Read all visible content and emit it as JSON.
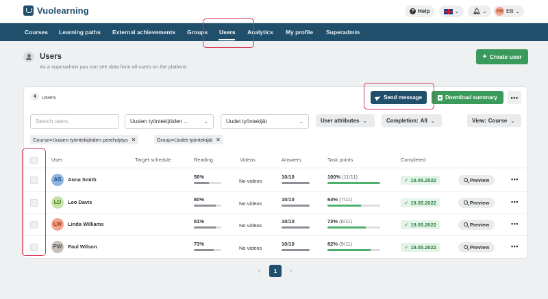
{
  "app": {
    "name": "Vuolearning"
  },
  "topbar": {
    "help": "Help",
    "user_initials": "EM",
    "user_name": "Elli"
  },
  "nav": [
    "Courses",
    "Learning paths",
    "External achievements",
    "Groups",
    "Users",
    "Analytics",
    "My profile",
    "Superadmin"
  ],
  "nav_active": "Users",
  "page": {
    "title": "Users",
    "subtitle": "As a superadmin you can see data from all users on the platform",
    "create_label": "Create user"
  },
  "card": {
    "count": "4",
    "count_label": "users",
    "send_label": "Send message",
    "download_label": "Download summary",
    "more": "•••"
  },
  "filters": {
    "search_placeholder": "Search users",
    "select1": "Uusien työntekijöiden ...",
    "select2": "Uudet työntekijät",
    "attributes": "User attributes",
    "completion_label": "Completion:",
    "completion_value": "All",
    "view_label": "View:",
    "view_value": "Course"
  },
  "tags": [
    "Course=Uusien työntekijöiden perehdytys",
    "Group=Uudet työntekijät"
  ],
  "table": {
    "headers": [
      "User",
      "Target schedule",
      "Reading",
      "Videos",
      "Answers",
      "Task points",
      "Completed"
    ],
    "rows": [
      {
        "initials": "AS",
        "name": "Anna Smith",
        "avatar_bg": "#8fb4dd",
        "avatar_fg": "#1f4f86",
        "reading": "56%",
        "reading_frac": 0.56,
        "videos": "No videos",
        "answers": "10/10",
        "answers_frac": 1.0,
        "task": "100%",
        "task_detail": "(11/11)",
        "task_frac": 1.0,
        "completed": "19.05.2022",
        "preview": "Preview",
        "more": "•••"
      },
      {
        "initials": "LD",
        "name": "Leo Davis",
        "avatar_bg": "#c5e2a8",
        "avatar_fg": "#4d7a25",
        "reading": "80%",
        "reading_frac": 0.8,
        "videos": "No videos",
        "answers": "10/10",
        "answers_frac": 1.0,
        "task": "64%",
        "task_detail": "(7/11)",
        "task_frac": 0.64,
        "completed": "19.05.2022",
        "preview": "Preview",
        "more": "•••"
      },
      {
        "initials": "LW",
        "name": "Linda Williams",
        "avatar_bg": "#f2a48c",
        "avatar_fg": "#a23d1c",
        "reading": "81%",
        "reading_frac": 0.81,
        "videos": "No videos",
        "answers": "10/10",
        "answers_frac": 1.0,
        "task": "73%",
        "task_detail": "(8/11)",
        "task_frac": 0.73,
        "completed": "19.05.2022",
        "preview": "Preview",
        "more": "•••"
      },
      {
        "initials": "PW",
        "name": "Paul Wilson",
        "avatar_bg": "#c9c2bb",
        "avatar_fg": "#5e5650",
        "reading": "73%",
        "reading_frac": 0.73,
        "videos": "No videos",
        "answers": "10/10",
        "answers_frac": 1.0,
        "task": "82%",
        "task_detail": "(9/11)",
        "task_frac": 0.82,
        "completed": "19.05.2022",
        "preview": "Preview",
        "more": "•••"
      }
    ]
  },
  "pagination": {
    "current": "1",
    "prev": "‹",
    "next": "›"
  },
  "colors": {
    "primary": "#1f4f6b",
    "success": "#3a9a5b",
    "highlight": "#d9304f"
  }
}
